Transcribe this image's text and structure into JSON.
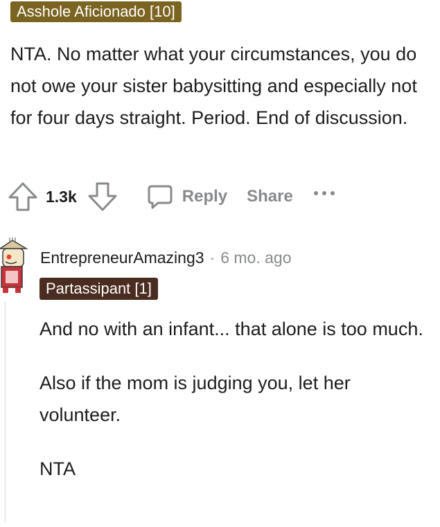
{
  "top_comment": {
    "flair": "Asshole Aficionado [10]",
    "paragraphs": [
      "NTA. No matter what your circumstances, you do not owe your sister babysitting and especially not for four days straight. Period. End of discussion."
    ],
    "score": "1.3k",
    "actions": {
      "reply_label": "Reply",
      "share_label": "Share"
    }
  },
  "reply_comment": {
    "author": "EntrepreneurAmazing3",
    "separator": "·",
    "time": "6 mo. ago",
    "flair": "Partassipant [1]",
    "paragraphs": [
      "And no with an infant... that alone is too much.",
      "Also if the mom is judging you, let her volunteer.",
      "NTA"
    ]
  },
  "colors": {
    "flair_top_bg": "#7b6320",
    "flair_reply_bg": "#4b2c20",
    "muted_text": "#878a8c"
  }
}
